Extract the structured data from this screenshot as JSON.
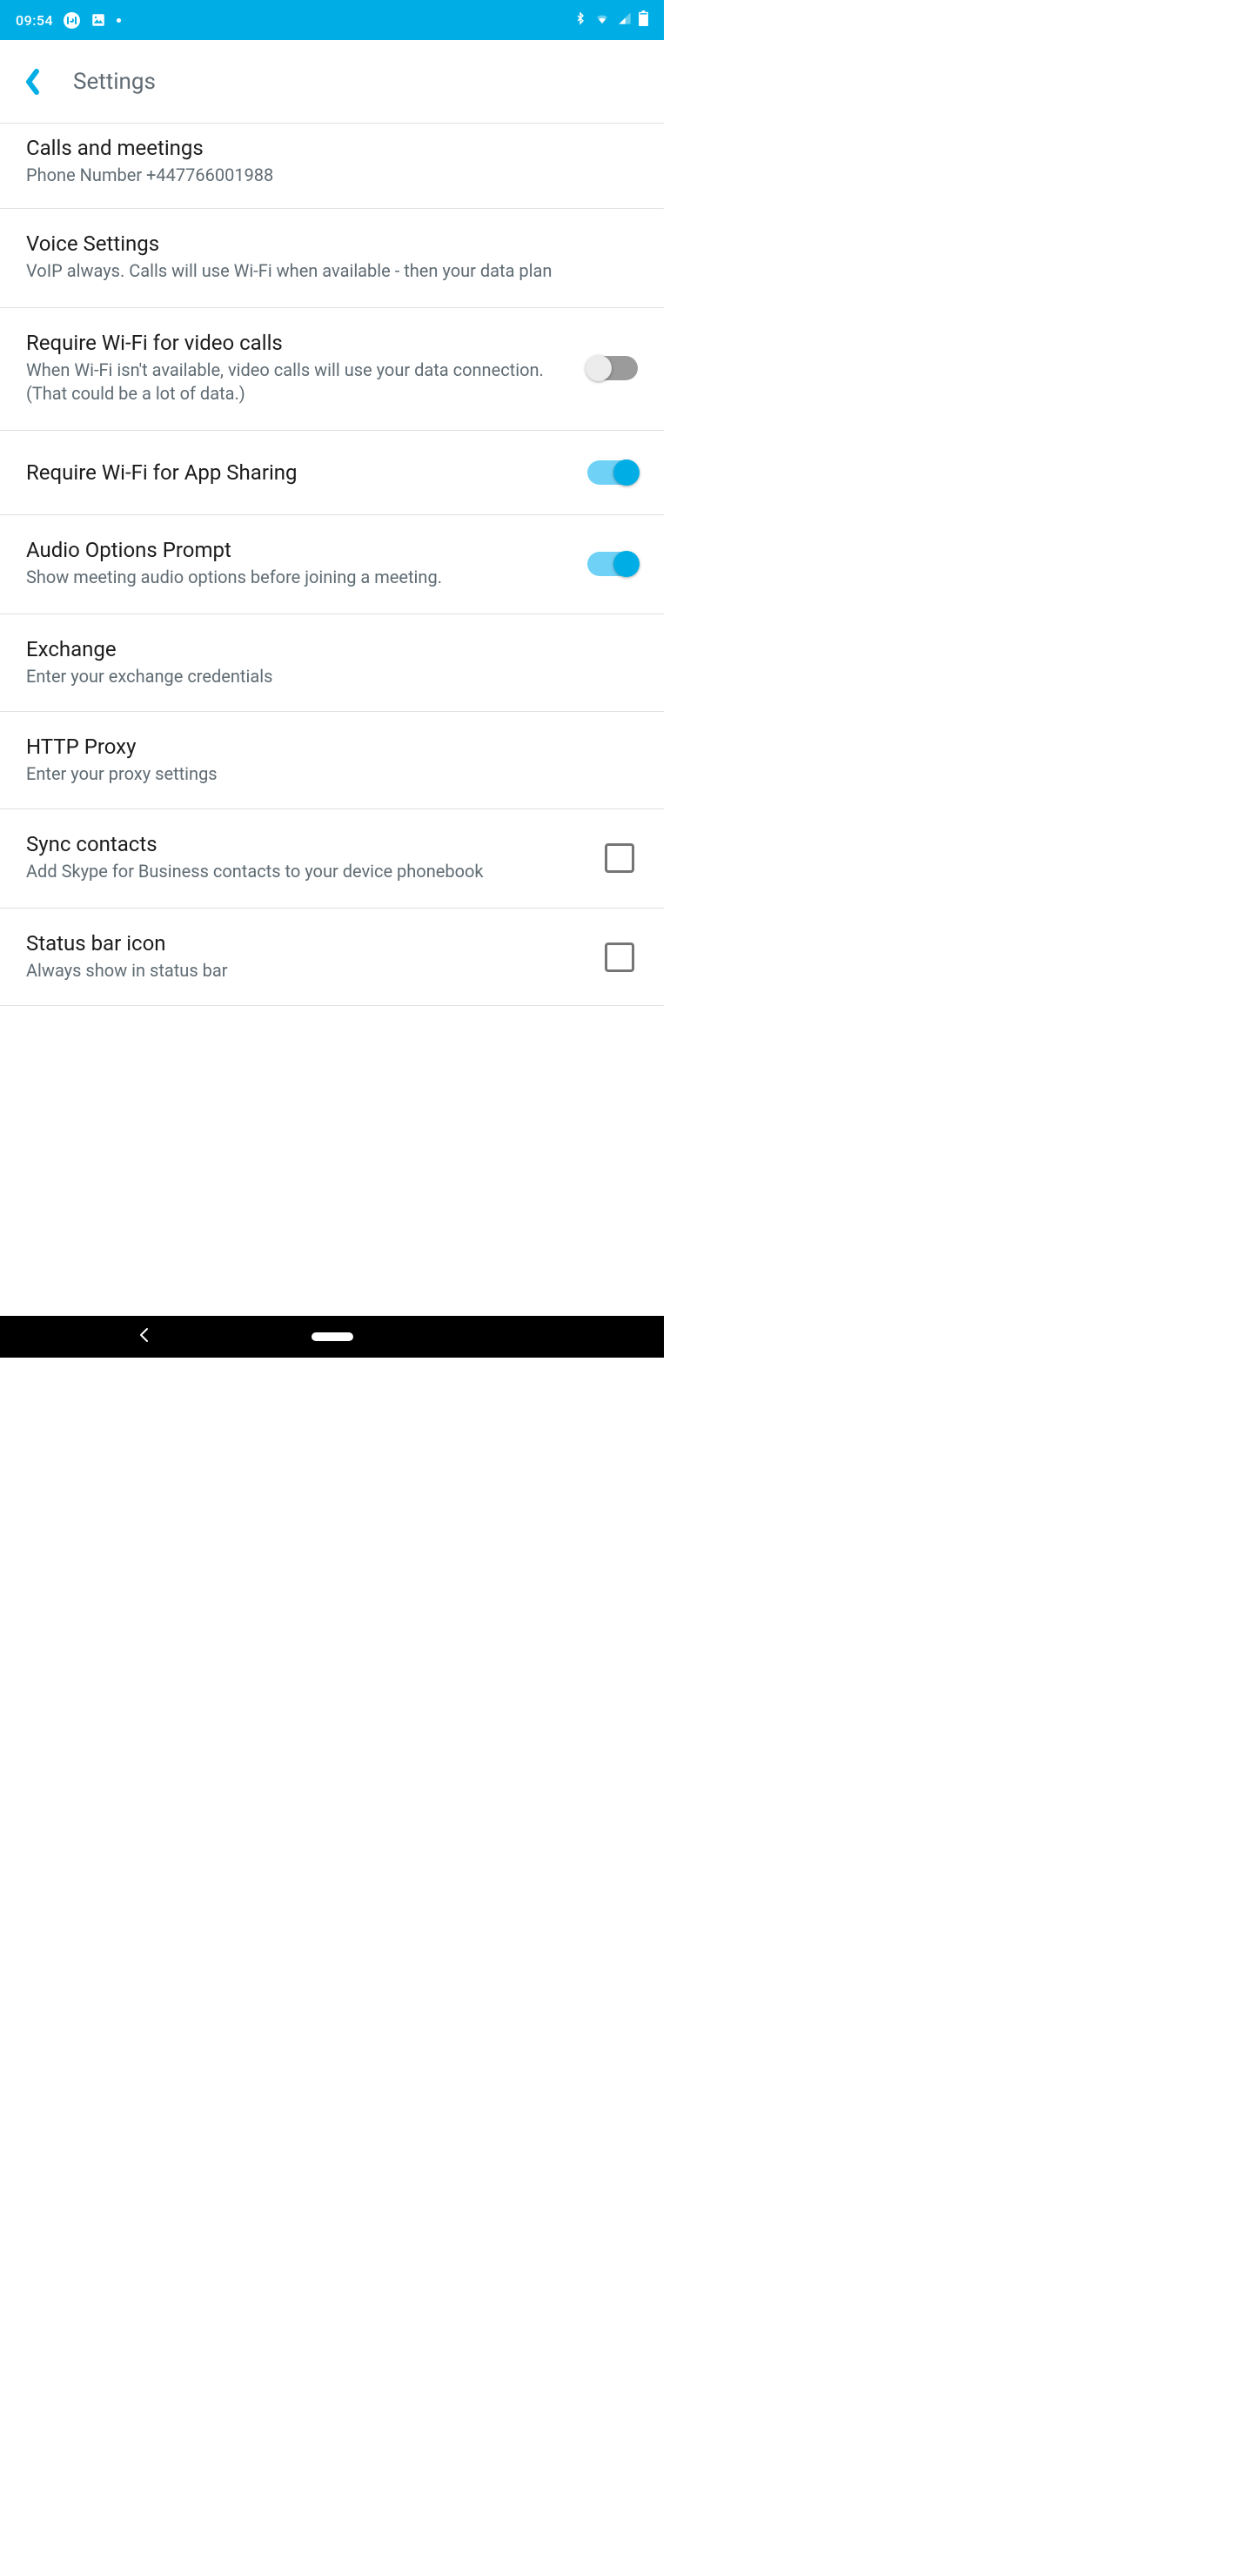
{
  "status": {
    "time": "09:54"
  },
  "app_bar": {
    "title": "Settings"
  },
  "rows": {
    "calls": {
      "title": "Calls and meetings",
      "sub": "Phone Number +447766001988"
    },
    "voice": {
      "title": "Voice Settings",
      "sub": "VoIP always. Calls will use Wi-Fi when available - then your data plan"
    },
    "wifi_video": {
      "title": "Require Wi-Fi for video calls",
      "sub": "When Wi-Fi isn't available, video calls will use your data connection. (That could be a lot of data.)",
      "on": false
    },
    "wifi_share": {
      "title": "Require Wi-Fi for App Sharing",
      "on": true
    },
    "audio_prompt": {
      "title": "Audio Options Prompt",
      "sub": "Show meeting audio options before joining a meeting.",
      "on": true
    },
    "exchange": {
      "title": "Exchange",
      "sub": "Enter your exchange credentials"
    },
    "proxy": {
      "title": "HTTP Proxy",
      "sub": "Enter your proxy settings"
    },
    "sync": {
      "title": "Sync contacts",
      "sub": "Add Skype for Business contacts to your device phonebook",
      "checked": false
    },
    "status_icon": {
      "title": "Status bar icon",
      "sub": "Always show in status bar",
      "checked": false
    }
  }
}
